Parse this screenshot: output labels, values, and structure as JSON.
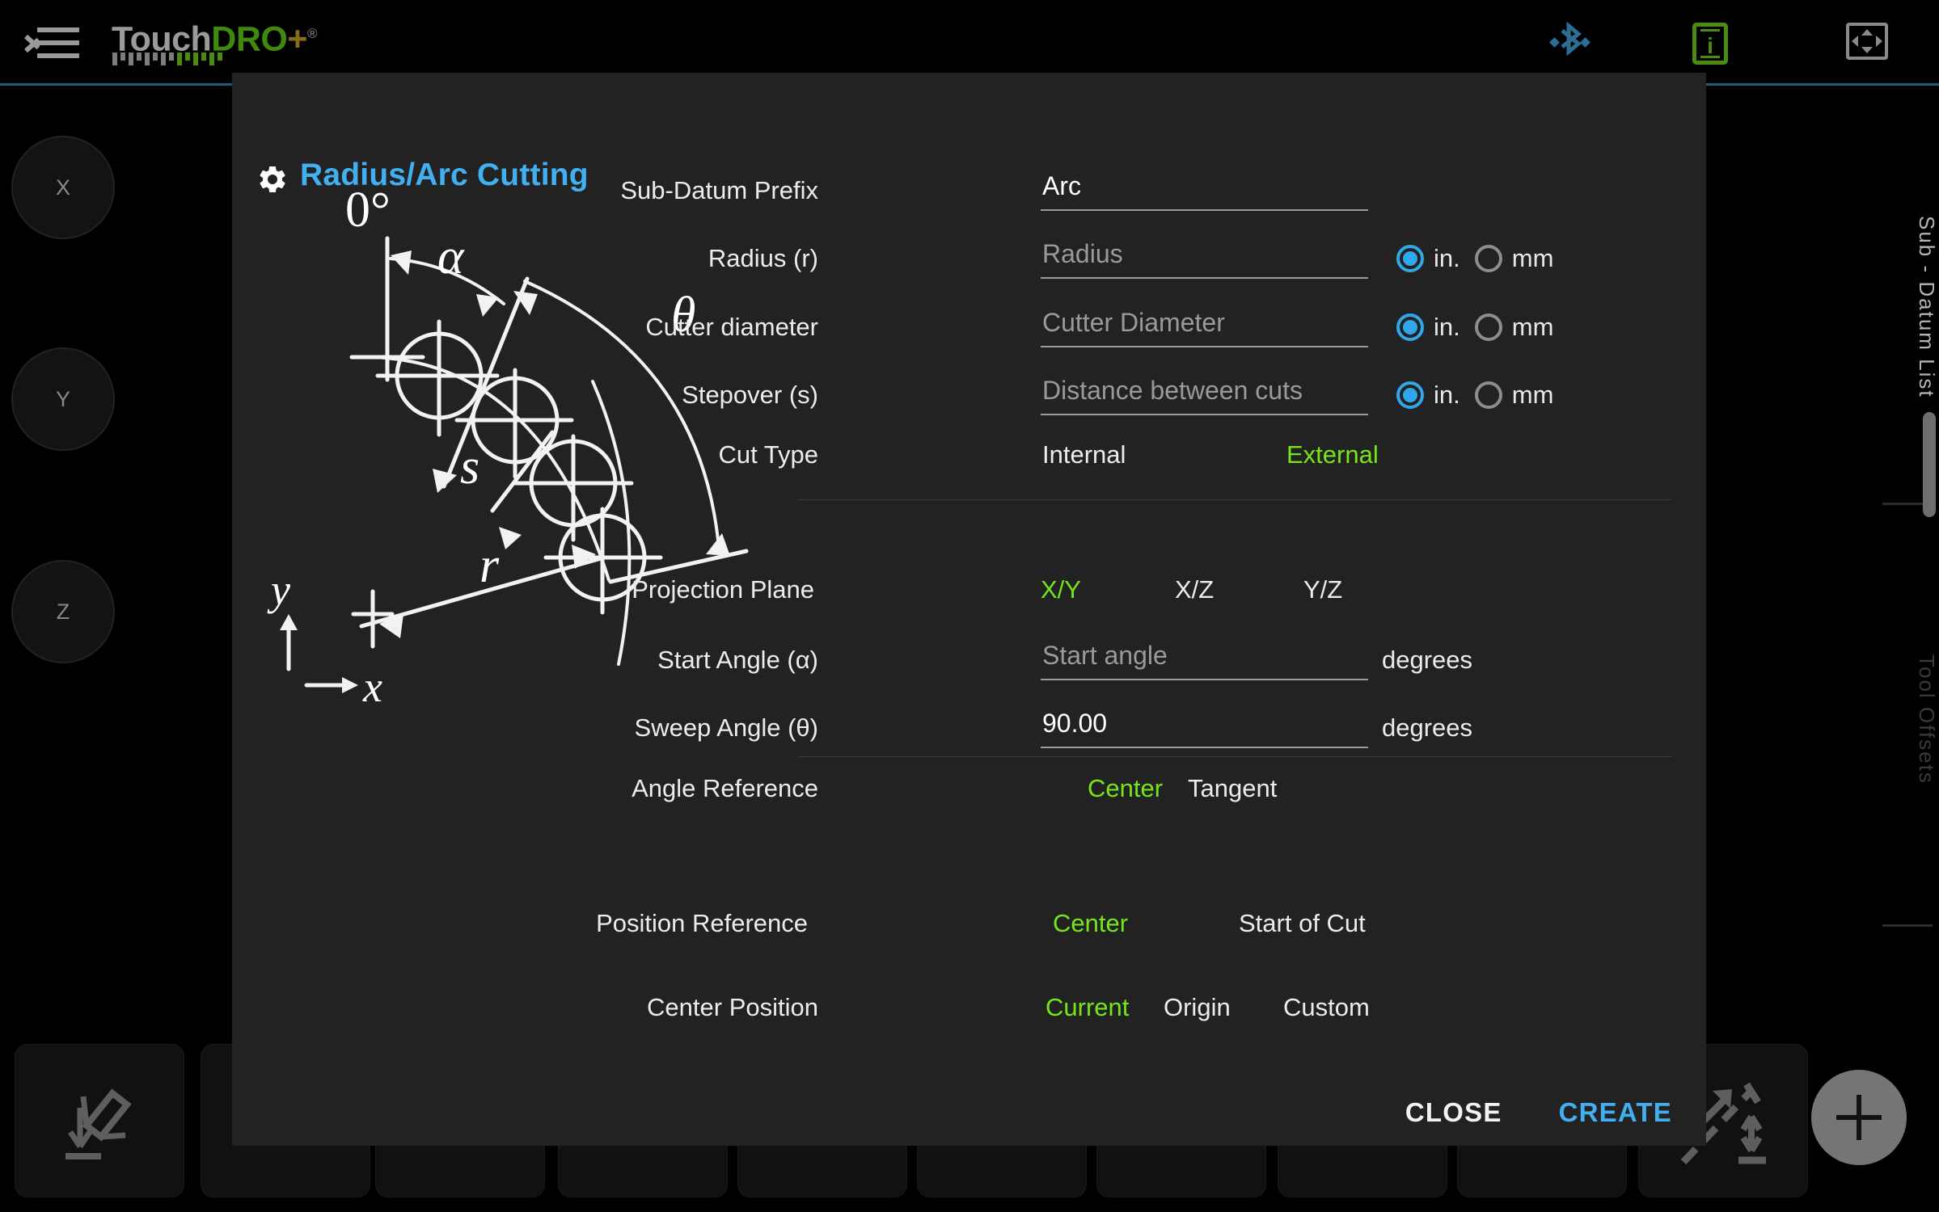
{
  "app": {
    "name": "TouchDRO",
    "logo_part1": "Touch",
    "logo_part2": "DRO",
    "logo_part3": "+",
    "logo_reg": "®",
    "menu_icon": "menu-collapse-icon",
    "bluetooth_icon": "bluetooth-icon",
    "device_info_icon": "device-info-icon",
    "fullscreen_icon": "fullscreen-icon"
  },
  "axes": [
    {
      "label": "X",
      "name": "axis-button-x"
    },
    {
      "label": "Y",
      "name": "axis-button-y"
    },
    {
      "label": "Z",
      "name": "axis-button-z"
    }
  ],
  "side_tabs": [
    {
      "label": "Sub - Datum List"
    },
    {
      "label": "Tool Offsets"
    }
  ],
  "dialog": {
    "icon": "gear-icon",
    "title": "Radius/Arc Cutting",
    "diagram": {
      "zero_label": "0°",
      "alpha_label": "α",
      "theta_label": "θ",
      "stepover_label": "s",
      "radius_label": "r",
      "axis_y": "y",
      "axis_x": "x"
    },
    "fields": {
      "sub_datum_prefix": {
        "label": "Sub-Datum Prefix",
        "value": "Arc",
        "placeholder": ""
      },
      "radius": {
        "label": "Radius (r)",
        "value": "",
        "placeholder": "Radius"
      },
      "cutter_diameter": {
        "label": "Cutter diameter",
        "value": "",
        "placeholder": "Cutter Diameter"
      },
      "stepover": {
        "label": "Stepover (s)",
        "value": "",
        "placeholder": "Distance between cuts"
      },
      "start_angle": {
        "label": "Start Angle (α)",
        "value": "",
        "placeholder": "Start angle",
        "suffix": "degrees"
      },
      "sweep_angle": {
        "label": "Sweep Angle (θ)",
        "value": "90.00",
        "placeholder": "",
        "suffix": "degrees"
      }
    },
    "units": {
      "inch_label": "in.",
      "mm_label": "mm",
      "radius_selected": "in.",
      "cutter_selected": "in.",
      "stepover_selected": "in."
    },
    "cut_type": {
      "label": "Cut Type",
      "options": [
        "Internal",
        "External"
      ],
      "selected": "External"
    },
    "projection_plane": {
      "label": "Projection Plane",
      "options": [
        "X/Y",
        "X/Z",
        "Y/Z"
      ],
      "selected": "X/Y"
    },
    "angle_reference": {
      "label": "Angle Reference",
      "options": [
        "Center",
        "Tangent"
      ],
      "selected": "Center"
    },
    "position_reference": {
      "label": "Position Reference",
      "options": [
        "Center",
        "Start of Cut"
      ],
      "selected": "Center"
    },
    "center_position": {
      "label": "Center Position",
      "options": [
        "Current",
        "Origin",
        "Custom"
      ],
      "selected": "Current"
    },
    "buttons": {
      "close": "CLOSE",
      "create": "CREATE"
    }
  },
  "toolbar": {
    "buttons": [
      {
        "name": "tool-set-datum-icon"
      },
      {
        "name": "tool-move-to-icon"
      },
      {
        "name": "tool-set-zero-icon"
      },
      {
        "name": "tool-zero-to-edge-icon"
      },
      {
        "name": "tool-bolt-circle-icon"
      },
      {
        "name": "tool-bolt-arc-icon"
      },
      {
        "name": "tool-line-holes-icon"
      },
      {
        "name": "tool-circle-a-icon"
      },
      {
        "name": "tool-circle-b-icon"
      },
      {
        "name": "tool-radius-arc-icon"
      }
    ],
    "fab": {
      "name": "add-button",
      "label": "+"
    }
  },
  "colors": {
    "accent_blue": "#42b0f0",
    "selected_green": "#76e61a",
    "radio_blue": "#31a6e8",
    "dialog_bg": "#222222",
    "page_bg": "#000000"
  }
}
